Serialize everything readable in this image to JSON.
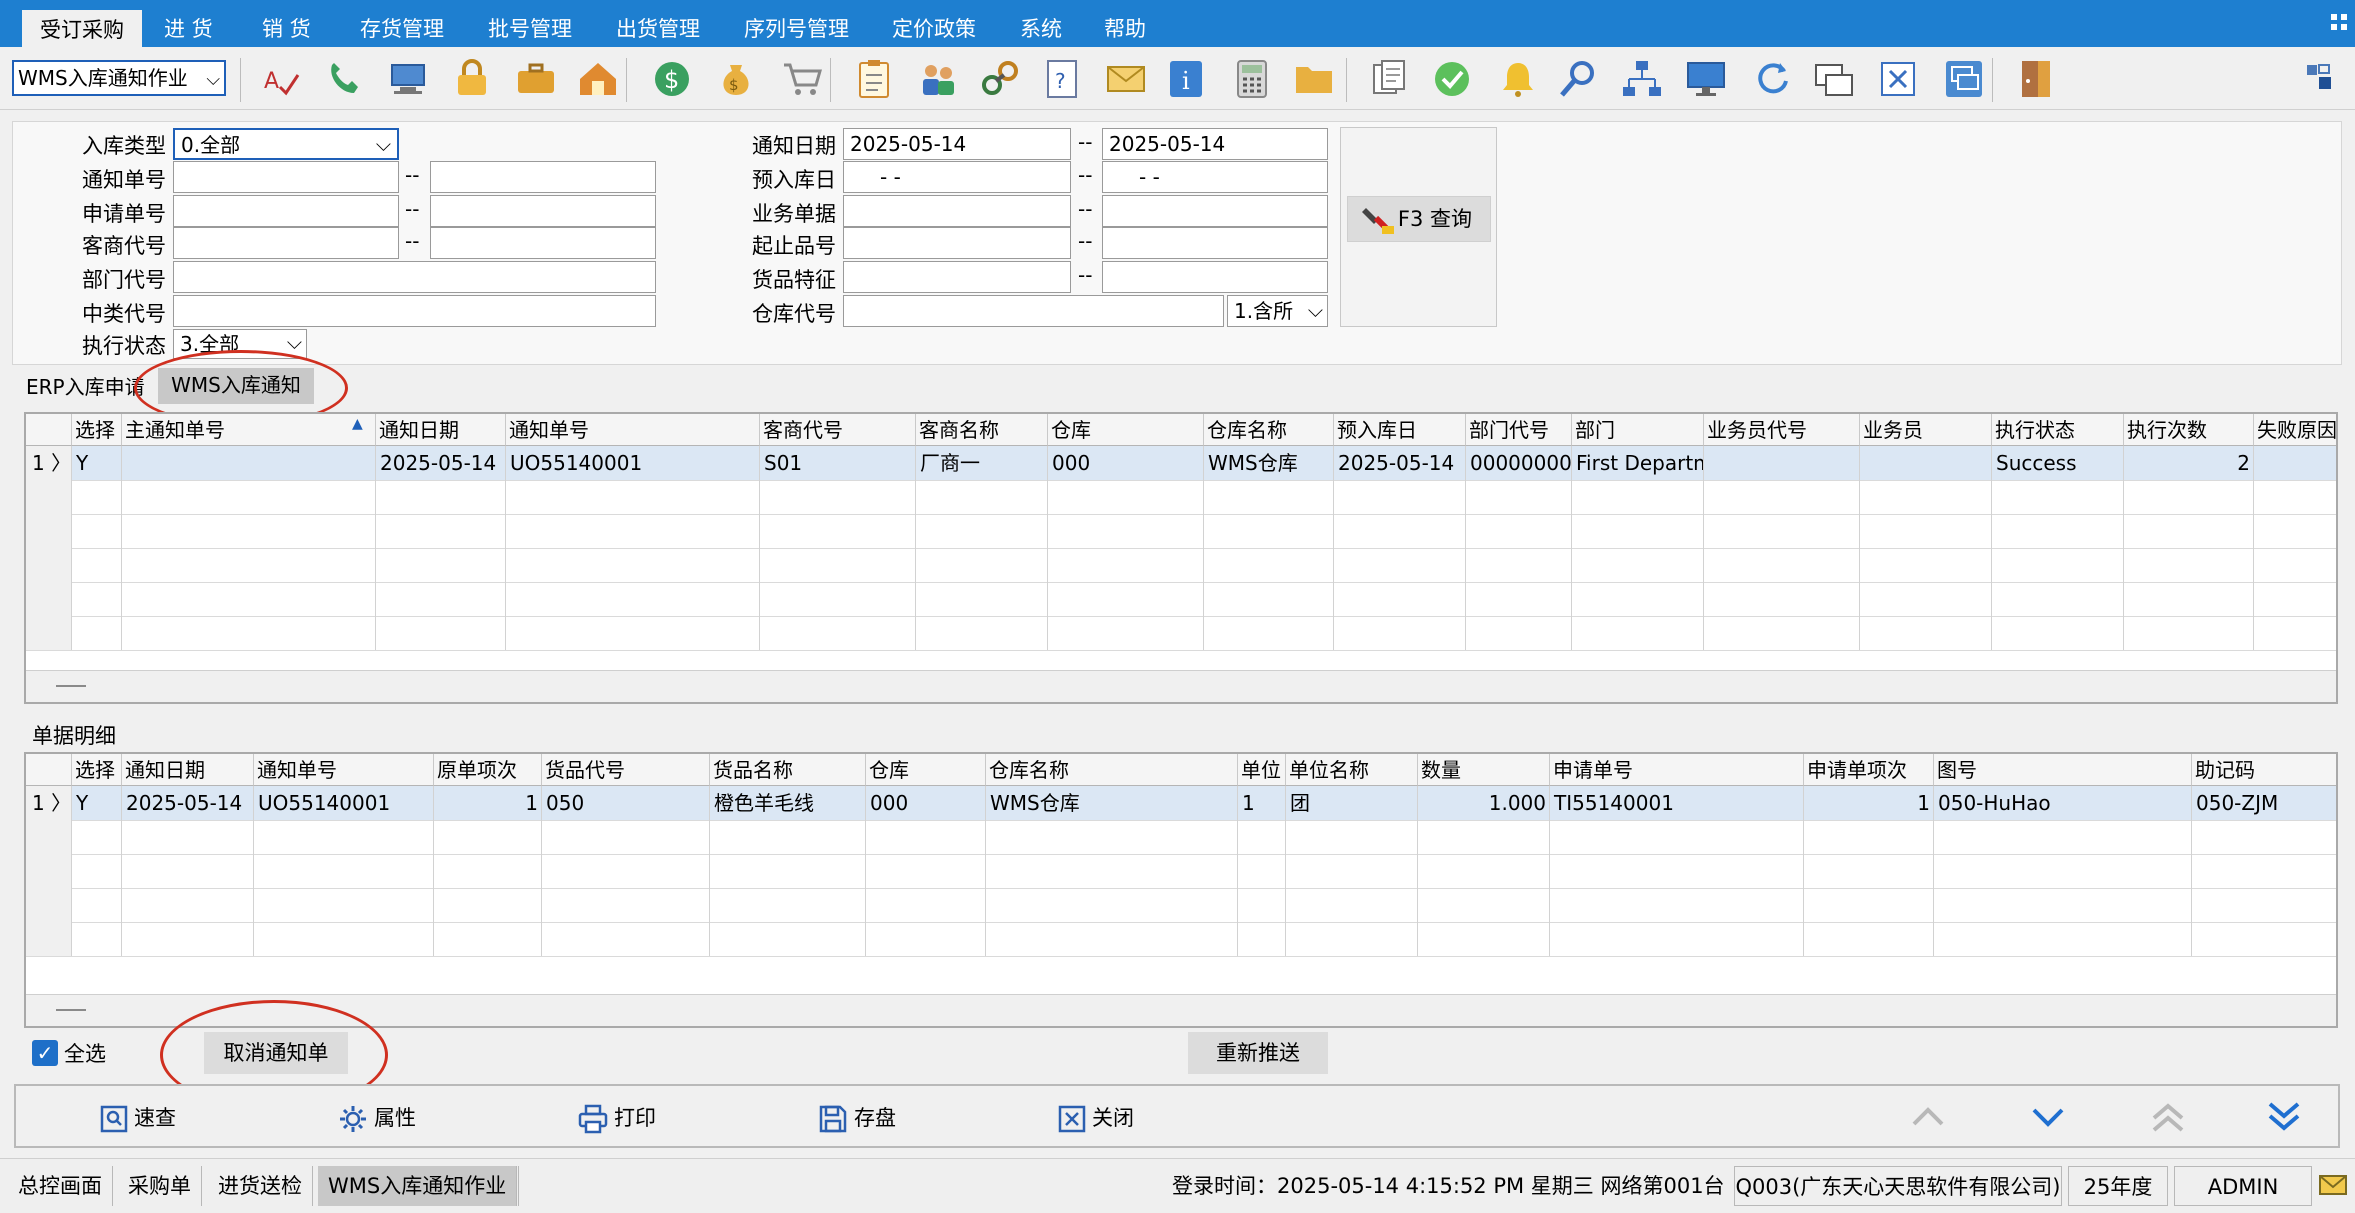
{
  "menubar": {
    "items": [
      "受订采购",
      "进  货",
      "销  货",
      "存货管理",
      "批号管理",
      "出货管理",
      "序列号管理",
      "定价政策",
      "系统",
      "帮助"
    ]
  },
  "toolbar": {
    "module_select": "WMS入库通知作业",
    "icons": [
      "spell-check-icon",
      "phone-icon",
      "computer-icon",
      "lock-icon",
      "briefcase-icon",
      "house-icon",
      "dollar-icon",
      "money-bag-icon",
      "cart-icon",
      "clipboard-icon",
      "users-icon",
      "link-icon",
      "help-doc-icon",
      "mail-icon",
      "info-icon",
      "calculator-icon",
      "folder-icon",
      "copy-icon",
      "check-icon",
      "bell-icon",
      "search-icon",
      "org-chart-icon",
      "monitor-icon",
      "refresh-icon",
      "windows-icon",
      "close-icon",
      "restore-icon",
      "exit-door-icon"
    ]
  },
  "filters": {
    "in_type_label": "入库类型",
    "in_type_value": "0.全部",
    "notice_no_label": "通知单号",
    "request_no_label": "申请单号",
    "vendor_code_label": "客商代号",
    "dept_code_label": "部门代号",
    "mid_class_label": "中类代号",
    "exec_status_label": "执行状态",
    "exec_status_value": "3.全部",
    "notice_date_label": "通知日期",
    "notice_date_from": "2025-05-14",
    "notice_date_to": "2025-05-14",
    "pre_date_label": "预入库日",
    "pre_date_from": "  -  -",
    "pre_date_to": "  -  -",
    "business_doc_label": "业务单据",
    "item_range_label": "起止品号",
    "item_feature_label": "货品特征",
    "warehouse_label": "仓库代号",
    "warehouse_scope": "1.含所",
    "dash": "--",
    "query_button": "F3 查询"
  },
  "tabs": [
    "ERP入库申请",
    "WMS入库通知"
  ],
  "main_grid": {
    "columns": [
      "选择",
      "主通知单号",
      "通知日期",
      "通知单号",
      "客商代号",
      "客商名称",
      "仓库",
      "仓库名称",
      "预入库日",
      "部门代号",
      "部门",
      "业务员代号",
      "业务员",
      "执行状态",
      "执行次数",
      "失败原因"
    ],
    "rows": [
      {
        "ind": "1 〉",
        "cells": [
          "Y",
          "",
          "2025-05-14",
          "UO55140001",
          "S01",
          "厂商一",
          "000",
          "WMS仓库",
          "2025-05-14",
          "00000000",
          "First Departm",
          "",
          "",
          "Success",
          "2",
          ""
        ]
      }
    ]
  },
  "detail": {
    "label": "单据明细",
    "columns": [
      "选择",
      "通知日期",
      "通知单号",
      "原单项次",
      "货品代号",
      "货品名称",
      "仓库",
      "仓库名称",
      "单位",
      "单位名称",
      "数量",
      "申请单号",
      "申请单项次",
      "图号",
      "助记码"
    ],
    "rows": [
      {
        "ind": "1 〉",
        "cells": [
          "Y",
          "2025-05-14",
          "UO55140001",
          "1",
          "050",
          "橙色羊毛线",
          "000",
          "WMS仓库",
          "1",
          "团",
          "1.000",
          "TI55140001",
          "1",
          "050-HuHao",
          "050-ZJM"
        ]
      }
    ]
  },
  "bottom": {
    "select_all": "全选",
    "cancel_notice": "取消通知单",
    "repush": "重新推送"
  },
  "actions": [
    "速查",
    "属性",
    "打印",
    "存盘",
    "关闭"
  ],
  "statusbar": {
    "tabs": [
      "总控画面",
      "采购单",
      "进货送检",
      "WMS入库通知作业"
    ],
    "login": "登录时间：2025-05-14 4:15:52 PM  星期三   网络第001台",
    "company": "Q003(广东天心天思软件有限公司)",
    "year": "25年度",
    "user": "ADMIN"
  },
  "colors": {
    "menubar": "#1e7fd0",
    "selected_row": "#dbe7f4",
    "annotation": "#d03020"
  }
}
